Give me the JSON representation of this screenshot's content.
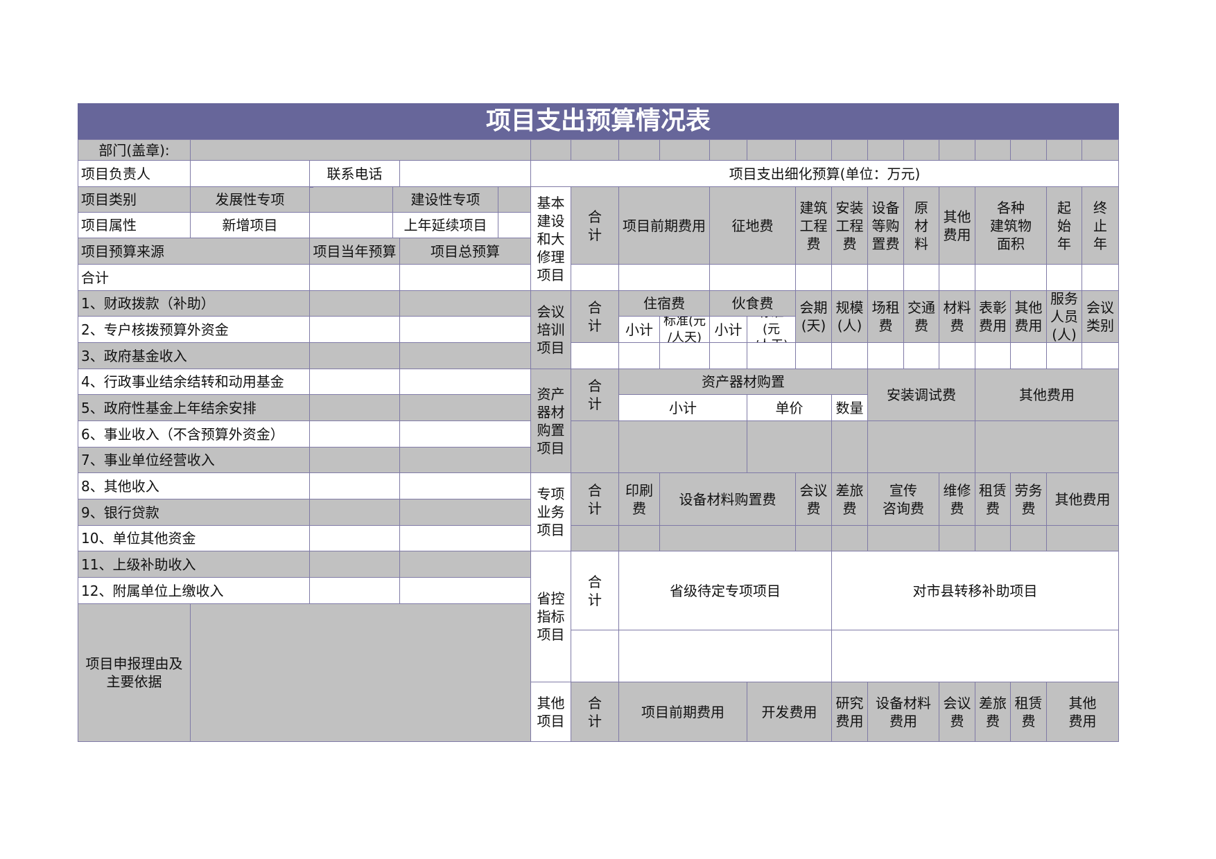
{
  "title": "项目支出预算情况表",
  "header": {
    "dept_label": "部门(盖章):",
    "leader_label": "项目负责人",
    "phone_label": "联系电话",
    "detail_title": "项目支出细化预算(单位：万元)"
  },
  "left": {
    "category_label": "项目类别",
    "category_opt1": "发展性专项",
    "category_opt2": "建设性专项",
    "attr_label": "项目属性",
    "attr_opt1": "新增项目",
    "attr_opt2": "上年延续项目",
    "source_label": "项目预算来源",
    "current_year": "项目当年预算",
    "total_budget": "项目总预算",
    "sources": [
      "合计",
      "1、财政拨款（补助）",
      "2、专户核拨预算外资金",
      "3、政府基金收入",
      "4、行政事业结余结转和动用基金",
      "5、政府性基金上年结余安排",
      "6、事业收入（不含预算外资金）",
      "7、事业单位经营收入",
      "8、其他收入",
      "9、银行贷款",
      "10、单位其他资金",
      "11、上级补助收入",
      "12、附属单位上缴收入"
    ],
    "reason_label": "项目申报理由及\n主要依据"
  },
  "right": {
    "total": "合\n计",
    "construction": {
      "label": "基本\n建设\n和大\n修理\n项目",
      "cols": [
        "项目前期费用",
        "征地费",
        "建筑\n工程\n费",
        "安装\n工程\n费",
        "设备\n等购\n置费",
        "原\n材\n料",
        "其他\n费用",
        "各种\n建筑物\n面积",
        "起\n始\n年",
        "终\n止\n年"
      ]
    },
    "meeting": {
      "label": "会议\n培训\n项目",
      "lodging": "住宿费",
      "food": "伙食费",
      "subtotal": "小计",
      "std1": "标准(元\n/人天)",
      "std2": "标准\n(元\n/人天)",
      "cols": [
        "会期\n(天)",
        "规模\n(人)",
        "场租\n费",
        "交通\n费",
        "材料\n费",
        "表彰\n费用",
        "其他\n费用",
        "服务\n人员\n(人)",
        "会议\n类别"
      ]
    },
    "asset": {
      "label": "资产\n器材\n购置\n项目",
      "purchase": "资产器材购置",
      "subtotal": "小计",
      "unit_price": "单价",
      "quantity": "数量",
      "install": "安装调试费",
      "other": "其他费用"
    },
    "special": {
      "label": "专项\n业务\n项目",
      "cols": [
        "印刷\n费",
        "设备材料购置费",
        "会议\n费",
        "差旅\n费",
        "宣传\n咨询费",
        "维修\n费",
        "租赁\n费",
        "劳务\n费",
        "其他费用"
      ]
    },
    "provincial": {
      "label": "省控\n指标\n项目",
      "pending": "省级待定专项项目",
      "transfer": "对市县转移补助项目"
    },
    "other": {
      "label": "其他\n项目",
      "cols": [
        "项目前期费用",
        "开发费用",
        "研究费用",
        "设备材料\n费用",
        "会议\n费",
        "差旅\n费",
        "租赁\n费",
        "其他\n费用"
      ]
    }
  }
}
